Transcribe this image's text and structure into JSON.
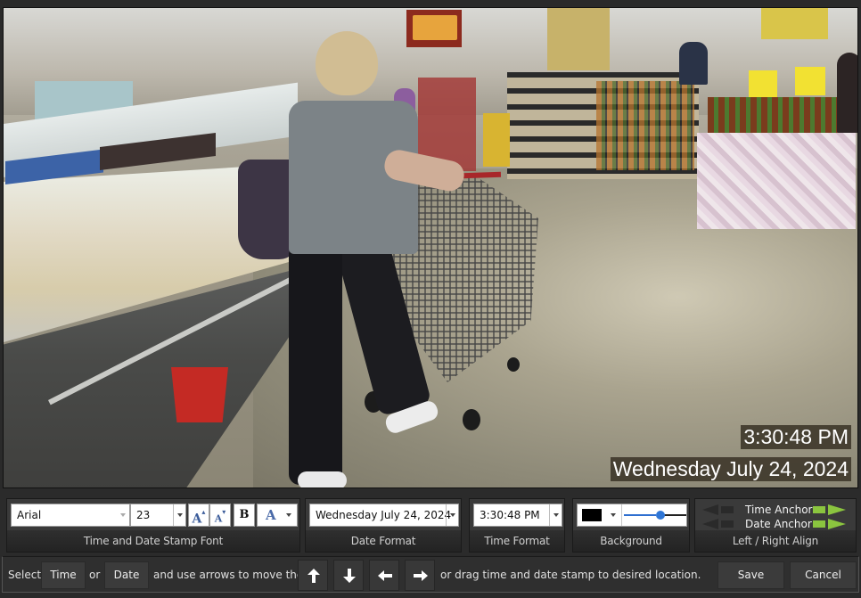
{
  "preview": {
    "description": "Grocery store photo preview with timestamp overlay",
    "time_stamp": "3:30:48 PM",
    "date_stamp": "Wednesday July 24, 2024",
    "stamp_background_color": "#40392c",
    "stamp_text_color": "#ffffff"
  },
  "font_group": {
    "caption": "Time and Date Stamp Font",
    "font_name": "Arial",
    "font_size": "23",
    "grow_font_label": "A",
    "shrink_font_label": "A",
    "bold_label": "B",
    "font_color_label": "A",
    "font_color": "#4a6aa8"
  },
  "date_group": {
    "caption": "Date Format",
    "selected": "Wednesday July 24, 2024"
  },
  "time_group": {
    "caption": "Time Format",
    "selected": "3:30:48 PM"
  },
  "background_group": {
    "caption": "Background",
    "color": "#000000",
    "opacity_fraction": 0.6
  },
  "align_group": {
    "caption": "Left / Right Align",
    "time_anchor_label": "Time Anchor",
    "date_anchor_label": "Date Anchor",
    "time_anchor": "right",
    "date_anchor": "right",
    "active_color": "#8bc53f",
    "inactive_color": "#2a2a2a"
  },
  "bottom_bar": {
    "select_label": "Select",
    "time_button": "Time",
    "or_label": "or",
    "date_button": "Date",
    "arrows_hint": "and use arrows to move them",
    "drag_hint": "or drag time and date stamp to desired location.",
    "save_button": "Save",
    "cancel_button": "Cancel"
  }
}
